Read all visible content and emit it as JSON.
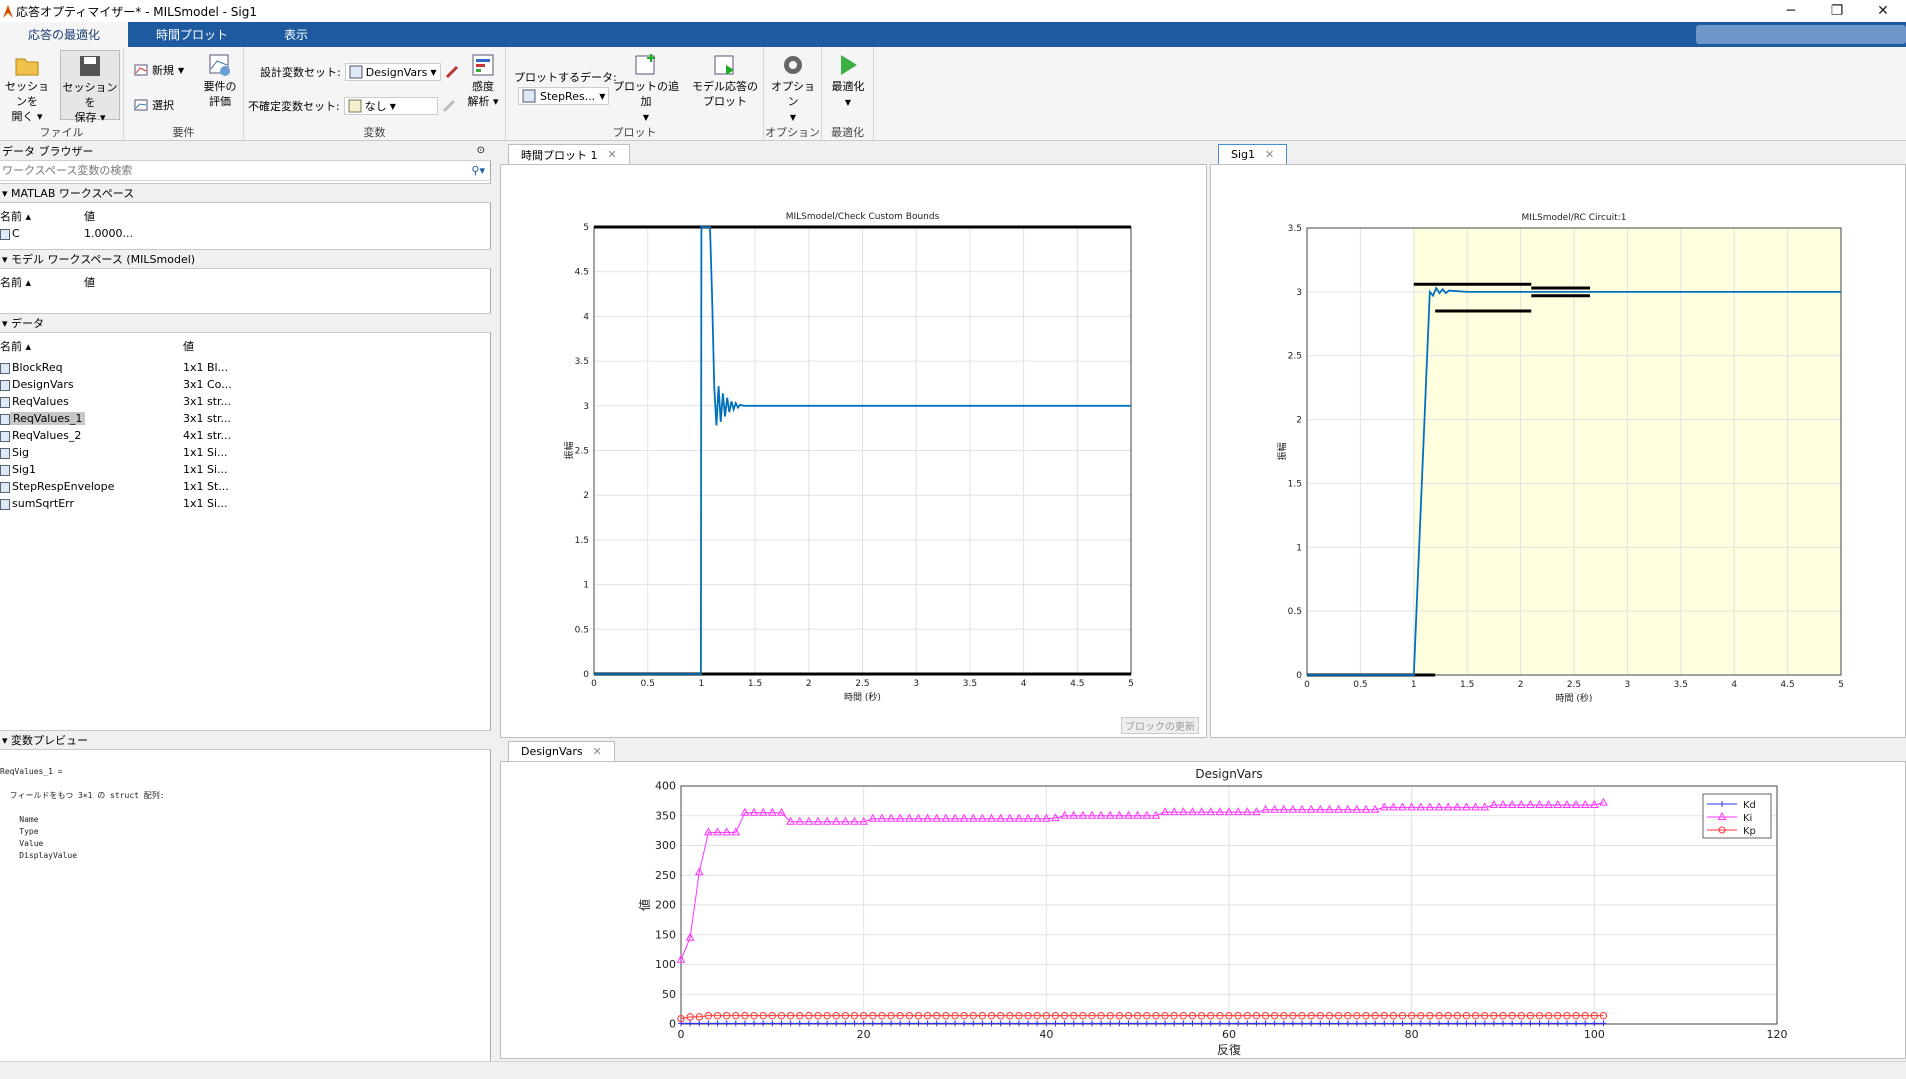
{
  "window": {
    "title": "応答オプティマイザー* - MILSmodel - Sig1",
    "min": "─",
    "restore": "❐",
    "close": "✕"
  },
  "ribbon_tabs": [
    "応答の最適化",
    "時間プロット",
    "表示"
  ],
  "ribbon": {
    "file": {
      "label": "ファイル",
      "open1": "セッションを",
      "open2": "開く ▾",
      "save1": "セッションを",
      "save2": "保存 ▾"
    },
    "req": {
      "label": "要件",
      "new": "新規",
      "select": "選択",
      "eval1": "要件の",
      "eval2": "評価"
    },
    "vars": {
      "label": "変数",
      "design_label": "設計変数セット:",
      "design_value": "DesignVars",
      "uncert_label": "不確定変数セット:",
      "uncert_value": "なし",
      "sens1": "感度",
      "sens2": "解析 ▾"
    },
    "plot": {
      "label": "プロット",
      "data_label": "プロットするデータ:",
      "data_value": "StepRes...",
      "add1": "プロットの追加",
      "model1": "モデル応答の",
      "model2": "プロット"
    },
    "opts": {
      "label": "オプション",
      "btn": "オプション"
    },
    "opt": {
      "label": "最適化",
      "btn": "最適化"
    }
  },
  "left": {
    "browser_title": "データ ブラウザー",
    "search_placeholder": "ワークスペース変数の検索",
    "matlab_ws": "MATLAB ワークスペース",
    "model_ws": "モデル ワークスペース (MILSmodel)",
    "data_title": "データ",
    "col_name": "名前 ▴",
    "col_value": "値",
    "ws_rows": [
      {
        "name": "C",
        "value": "1.0000..."
      }
    ],
    "data_rows": [
      {
        "name": "BlockReq",
        "value": "1x1 Bl..."
      },
      {
        "name": "DesignVars",
        "value": "3x1 Co..."
      },
      {
        "name": "ReqValues",
        "value": "3x1 str..."
      },
      {
        "name": "ReqValues_1",
        "value": "3x1 str..."
      },
      {
        "name": "ReqValues_2",
        "value": "4x1 str..."
      },
      {
        "name": "Sig",
        "value": "1x1 Si..."
      },
      {
        "name": "Sig1",
        "value": "1x1 Si..."
      },
      {
        "name": "StepRespEnvelope",
        "value": "1x1 St..."
      },
      {
        "name": "sumSqrtErr",
        "value": "1x1 Si..."
      }
    ],
    "preview_title": "変数プレビュー",
    "preview_text": "ReqValues_1 =\n\n  フィールドをもつ 3×1 の struct 配列:\n\n    Name\n    Type\n    Value\n    DisplayValue"
  },
  "tabs": {
    "plot1": "時間プロット 1",
    "sig1": "Sig1",
    "designvars": "DesignVars",
    "update_btn": "ブロックの更新"
  },
  "colors": {
    "line": "#0072bd",
    "bound": "#000000",
    "feasible": "#ffffe0",
    "kd": "#3333ff",
    "ki": "#ff33ff",
    "kp": "#ff3333"
  },
  "chart_data": [
    {
      "type": "line",
      "title": "MILSmodel/Check Custom Bounds",
      "xlabel": "時間 (秒)",
      "ylabel": "振幅",
      "xlim": [
        0,
        5
      ],
      "ylim": [
        0,
        5
      ],
      "xticks": [
        "0",
        "0.5",
        "1",
        "1.5",
        "2",
        "2.5",
        "3",
        "3.5",
        "4",
        "4.5",
        "5"
      ],
      "yticks": [
        "0",
        "0.5",
        "1",
        "1.5",
        "2",
        "2.5",
        "3",
        "3.5",
        "4",
        "4.5",
        "5"
      ],
      "bounds": [
        {
          "x": [
            0,
            5
          ],
          "y": [
            5,
            5
          ]
        },
        {
          "x": [
            0,
            5
          ],
          "y": [
            0,
            0
          ]
        }
      ],
      "series": [
        {
          "x": [
            0,
            0.995,
            1.0,
            1.04,
            1.08,
            1.1,
            1.12,
            1.14,
            1.16,
            1.18,
            1.2,
            1.22,
            1.24,
            1.26,
            1.28,
            1.3,
            1.32,
            1.34,
            1.36,
            1.4,
            1.45,
            1.5,
            2,
            3,
            4,
            5
          ],
          "y": [
            0,
            0,
            5,
            5,
            5,
            4.2,
            3.2,
            2.78,
            3.22,
            2.82,
            3.14,
            2.88,
            3.09,
            2.93,
            3.05,
            2.96,
            3.03,
            2.98,
            3.01,
            3.0,
            3.0,
            3.0,
            3.0,
            3.0,
            3.0,
            3.0
          ]
        }
      ]
    },
    {
      "type": "line",
      "title": "MILSmodel/RC Circuit:1",
      "xlabel": "時間 (秒)",
      "ylabel": "振幅",
      "xlim": [
        0,
        5
      ],
      "ylim": [
        0,
        3.5
      ],
      "xticks": [
        "0",
        "0.5",
        "1",
        "1.5",
        "2",
        "2.5",
        "3",
        "3.5",
        "4",
        "4.5",
        "5"
      ],
      "yticks": [
        "0",
        "0.5",
        "1",
        "1.5",
        "2",
        "2.5",
        "3",
        "3.5"
      ],
      "shaded_x": [
        1,
        5
      ],
      "bounds": [
        {
          "x": [
            1,
            2.1
          ],
          "y": [
            3.06,
            3.06
          ]
        },
        {
          "x": [
            2.1,
            2.65
          ],
          "y": [
            3.03,
            3.03
          ]
        },
        {
          "x": [
            1.2,
            2.1
          ],
          "y": [
            2.85,
            2.85
          ]
        },
        {
          "x": [
            2.1,
            2.65
          ],
          "y": [
            2.97,
            2.97
          ]
        },
        {
          "x": [
            0,
            1.2
          ],
          "y": [
            0,
            0
          ]
        }
      ],
      "series": [
        {
          "x": [
            0,
            1.0,
            1.15,
            1.18,
            1.21,
            1.24,
            1.27,
            1.3,
            1.33,
            1.5,
            2,
            3,
            4,
            5
          ],
          "y": [
            0,
            0,
            3.0,
            2.97,
            3.03,
            2.99,
            3.02,
            2.99,
            3.01,
            3.0,
            3.0,
            3.0,
            3.0,
            3.0
          ]
        }
      ]
    },
    {
      "type": "line",
      "title": "DesignVars",
      "xlabel": "反復",
      "ylabel": "値",
      "xlim": [
        0,
        120
      ],
      "ylim": [
        0,
        400
      ],
      "xticks": [
        "0",
        "20",
        "40",
        "60",
        "80",
        "100",
        "120"
      ],
      "yticks": [
        "0",
        "50",
        "100",
        "150",
        "200",
        "250",
        "300",
        "350",
        "400"
      ],
      "legend": "top-right",
      "series": [
        {
          "name": "Kd",
          "marker": "+",
          "steps": [
            [
              0,
              1
            ],
            [
              101,
              1
            ]
          ]
        },
        {
          "name": "Ki",
          "marker": "triangle",
          "steps": [
            [
              0,
              108
            ],
            [
              1,
              145
            ],
            [
              2,
              255
            ],
            [
              3,
              322
            ],
            [
              4,
              322
            ],
            [
              5,
              322
            ],
            [
              6,
              322
            ],
            [
              7,
              355
            ],
            [
              8,
              355
            ],
            [
              9,
              355
            ],
            [
              10,
              355
            ],
            [
              11,
              355
            ],
            [
              12,
              340
            ],
            [
              13,
              340
            ],
            [
              14,
              340
            ],
            [
              15,
              340
            ],
            [
              16,
              340
            ],
            [
              17,
              340
            ],
            [
              18,
              340
            ],
            [
              19,
              340
            ],
            [
              20,
              340
            ],
            [
              21,
              345
            ],
            [
              30,
              345
            ],
            [
              41,
              346
            ],
            [
              42,
              350
            ],
            [
              52,
              350
            ],
            [
              53,
              356
            ],
            [
              63,
              356
            ],
            [
              64,
              360
            ],
            [
              76,
              360
            ],
            [
              77,
              364
            ],
            [
              88,
              364
            ],
            [
              89,
              368
            ],
            [
              101,
              372
            ]
          ]
        },
        {
          "name": "Kp",
          "marker": "circle",
          "steps": [
            [
              0,
              9
            ],
            [
              1,
              12
            ],
            [
              3,
              14
            ],
            [
              101,
              14
            ]
          ]
        }
      ]
    }
  ]
}
